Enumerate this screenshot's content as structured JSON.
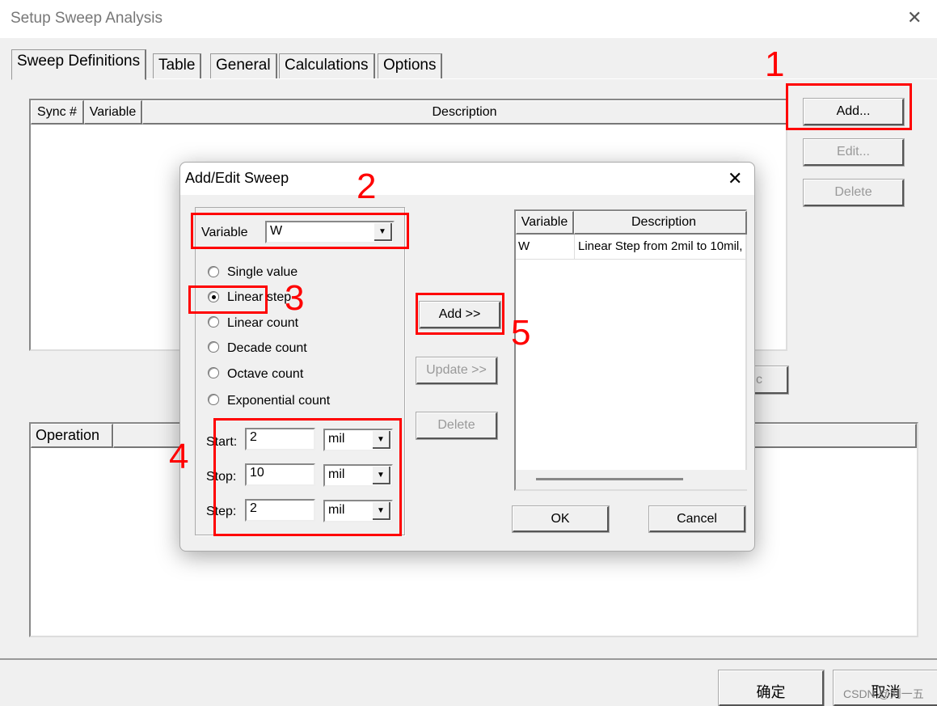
{
  "window": {
    "title": "Setup Sweep Analysis",
    "close_icon": "close-icon"
  },
  "tabs": [
    {
      "label": "Sweep Definitions",
      "active": true
    },
    {
      "label": "Table"
    },
    {
      "label": "General"
    },
    {
      "label": "Calculations"
    },
    {
      "label": "Options"
    }
  ],
  "sweep_table": {
    "columns": [
      "Sync #",
      "Variable",
      "Description"
    ]
  },
  "side_buttons": {
    "add": "Add...",
    "edit": "Edit...",
    "delete": "Delete",
    "partial": "c"
  },
  "operation_table": {
    "columns": [
      "Operation"
    ]
  },
  "footer": {
    "ok": "确定",
    "cancel": "取消"
  },
  "watermark": "CSDN @刘一五",
  "annotations": {
    "n1": "1",
    "n2": "2",
    "n3": "3",
    "n4": "4",
    "n5": "5",
    "color": "#ff0000"
  },
  "dialog": {
    "title": "Add/Edit Sweep",
    "variable_label": "Variable",
    "variable_value": "W",
    "options": [
      "Single value",
      "Linear step",
      "Linear count",
      "Decade count",
      "Octave count",
      "Exponential count"
    ],
    "selected_option": "Linear step",
    "start": {
      "label": "Start:",
      "value": "2",
      "unit": "mil"
    },
    "stop": {
      "label": "Stop:",
      "value": "10",
      "unit": "mil"
    },
    "step": {
      "label": "Step:",
      "value": "2",
      "unit": "mil"
    },
    "add_button": "Add >>",
    "update_button": "Update >>",
    "delete_button": "Delete",
    "table": {
      "columns": [
        "Variable",
        "Description"
      ],
      "rows": [
        {
          "variable": "W",
          "description": "Linear Step from 2mil to 10mil,"
        }
      ]
    },
    "ok": "OK",
    "cancel": "Cancel"
  }
}
